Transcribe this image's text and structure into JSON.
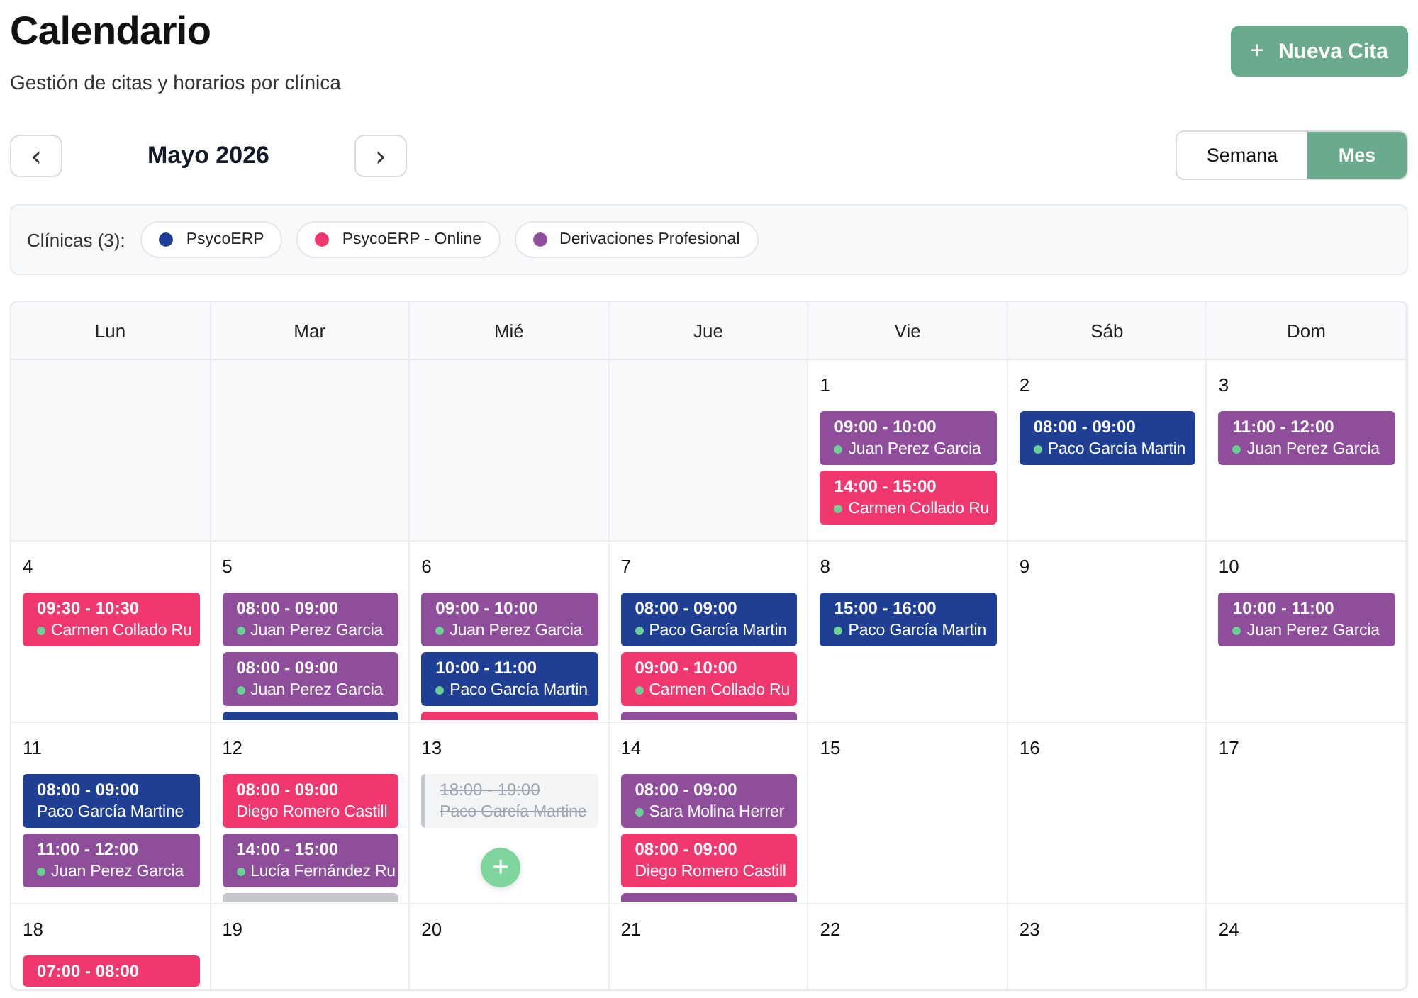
{
  "header": {
    "title": "Calendario",
    "subtitle": "Gestión de citas y horarios por clínica",
    "new_button": {
      "icon": "+",
      "label": "Nueva Cita"
    }
  },
  "nav": {
    "prev": "‹",
    "month": "Mayo 2026",
    "next": "›",
    "views": [
      {
        "label": "Semana",
        "selected": false
      },
      {
        "label": "Mes",
        "selected": true
      }
    ]
  },
  "clinics": {
    "label": "Clínicas (3):",
    "items": [
      {
        "name": "PsycoERP",
        "color": "#1e3f94"
      },
      {
        "name": "PsycoERP - Online",
        "color": "#f0386f"
      },
      {
        "name": "Derivaciones Profesional",
        "color": "#8e4e9b"
      }
    ]
  },
  "calendar": {
    "weekdays": [
      "Lun",
      "Mar",
      "Mié",
      "Jue",
      "Vie",
      "Sáb",
      "Dom"
    ],
    "weeks": [
      [
        {
          "kind": "blank"
        },
        {
          "kind": "blank"
        },
        {
          "kind": "blank"
        },
        {
          "kind": "blank"
        },
        {
          "kind": "day",
          "date": "1",
          "events": [
            {
              "kind": "appointment",
              "color": "#8e4e9b",
              "time": "09:00 - 10:00",
              "patient": "Juan Perez Garcia",
              "confirmed": true
            },
            {
              "kind": "appointment",
              "color": "#f0386f",
              "time": "14:00 - 15:00",
              "patient": "Carmen Collado Ru",
              "confirmed": true
            }
          ]
        },
        {
          "kind": "day",
          "date": "2",
          "events": [
            {
              "kind": "appointment",
              "color": "#1e3f94",
              "time": "08:00 - 09:00",
              "patient": "Paco García Martin",
              "confirmed": true
            }
          ]
        },
        {
          "kind": "day",
          "date": "3",
          "events": [
            {
              "kind": "appointment",
              "color": "#8e4e9b",
              "time": "11:00 - 12:00",
              "patient": "Juan Perez Garcia",
              "confirmed": true
            }
          ]
        }
      ],
      [
        {
          "kind": "day",
          "date": "4",
          "events": [
            {
              "kind": "appointment",
              "color": "#f0386f",
              "time": "09:30 - 10:30",
              "patient": "Carmen Collado Ru",
              "confirmed": true
            }
          ]
        },
        {
          "kind": "day",
          "date": "5",
          "events": [
            {
              "kind": "appointment",
              "color": "#8e4e9b",
              "time": "08:00 - 09:00",
              "patient": "Juan Perez Garcia",
              "confirmed": true
            },
            {
              "kind": "appointment",
              "color": "#8e4e9b",
              "time": "08:00 - 09:00",
              "patient": "Juan Perez Garcia",
              "confirmed": true
            },
            {
              "kind": "overflow",
              "color": "#1e3f94"
            }
          ]
        },
        {
          "kind": "day",
          "date": "6",
          "events": [
            {
              "kind": "appointment",
              "color": "#8e4e9b",
              "time": "09:00 - 10:00",
              "patient": "Juan Perez Garcia",
              "confirmed": true
            },
            {
              "kind": "appointment",
              "color": "#1e3f94",
              "time": "10:00 - 11:00",
              "patient": "Paco García Martin",
              "confirmed": true
            },
            {
              "kind": "overflow",
              "color": "#f0386f"
            }
          ]
        },
        {
          "kind": "day",
          "date": "7",
          "events": [
            {
              "kind": "appointment",
              "color": "#1e3f94",
              "time": "08:00 - 09:00",
              "patient": "Paco García Martin",
              "confirmed": true
            },
            {
              "kind": "appointment",
              "color": "#f0386f",
              "time": "09:00 - 10:00",
              "patient": "Carmen Collado Ru",
              "confirmed": true
            },
            {
              "kind": "overflow",
              "color": "#8e4e9b"
            }
          ]
        },
        {
          "kind": "day",
          "date": "8",
          "events": [
            {
              "kind": "appointment",
              "color": "#1e3f94",
              "time": "15:00 - 16:00",
              "patient": "Paco García Martin",
              "confirmed": true
            }
          ]
        },
        {
          "kind": "day",
          "date": "9"
        },
        {
          "kind": "day",
          "date": "10",
          "events": [
            {
              "kind": "appointment",
              "color": "#8e4e9b",
              "time": "10:00 - 11:00",
              "patient": "Juan Perez Garcia",
              "confirmed": true
            }
          ]
        }
      ],
      [
        {
          "kind": "day",
          "date": "11",
          "events": [
            {
              "kind": "appointment",
              "color": "#1e3f94",
              "time": "08:00 - 09:00",
              "patient": "Paco García Martine",
              "confirmed": false
            },
            {
              "kind": "appointment",
              "color": "#8e4e9b",
              "time": "11:00 - 12:00",
              "patient": "Juan Perez Garcia",
              "confirmed": true
            }
          ]
        },
        {
          "kind": "day",
          "date": "12",
          "events": [
            {
              "kind": "appointment",
              "color": "#f0386f",
              "time": "08:00 - 09:00",
              "patient": "Diego Romero Castill",
              "confirmed": false
            },
            {
              "kind": "appointment",
              "color": "#8e4e9b",
              "time": "14:00 - 15:00",
              "patient": "Lucía Fernández Ru",
              "confirmed": true
            },
            {
              "kind": "overflow",
              "color": "#c4c7cc"
            }
          ]
        },
        {
          "kind": "day",
          "date": "13",
          "add_button": "+",
          "events": [
            {
              "kind": "cancelled",
              "time": "18:00 - 19:00",
              "patient": "Paco García Martine"
            }
          ]
        },
        {
          "kind": "day",
          "date": "14",
          "events": [
            {
              "kind": "appointment",
              "color": "#8e4e9b",
              "time": "08:00 - 09:00",
              "patient": "Sara Molina Herrer",
              "confirmed": true
            },
            {
              "kind": "appointment",
              "color": "#f0386f",
              "time": "08:00 - 09:00",
              "patient": "Diego Romero Castill",
              "confirmed": false
            },
            {
              "kind": "overflow",
              "color": "#8e4e9b"
            }
          ]
        },
        {
          "kind": "day",
          "date": "15"
        },
        {
          "kind": "day",
          "date": "16"
        },
        {
          "kind": "day",
          "date": "17"
        }
      ],
      [
        {
          "kind": "day",
          "date": "18",
          "events": [
            {
              "kind": "appointment",
              "color": "#f0386f",
              "time": "07:00 - 08:00"
            }
          ]
        },
        {
          "kind": "day",
          "date": "19"
        },
        {
          "kind": "day",
          "date": "20"
        },
        {
          "kind": "day",
          "date": "21"
        },
        {
          "kind": "day",
          "date": "22"
        },
        {
          "kind": "day",
          "date": "23"
        },
        {
          "kind": "day",
          "date": "24"
        }
      ]
    ]
  }
}
